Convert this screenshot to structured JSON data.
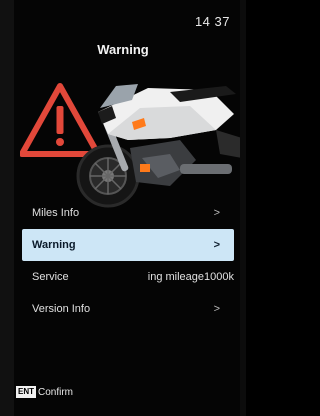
{
  "status_bar": {
    "time": "14 37"
  },
  "header": {
    "title": "Warning"
  },
  "hero": {
    "warning_icon": "warning-triangle-icon",
    "image": "motorcycle"
  },
  "menu": {
    "items": [
      {
        "label": "Miles Info",
        "value": "",
        "chevron": ">",
        "selected": false
      },
      {
        "label": "Warning",
        "value": "",
        "chevron": ">",
        "selected": true
      },
      {
        "label": "Service",
        "value": "ing mileage1000k",
        "chevron": "",
        "selected": false
      },
      {
        "label": "Version Info",
        "value": "",
        "chevron": ">",
        "selected": false
      }
    ]
  },
  "footer": {
    "key_label": "ENT",
    "action_label": "Confirm"
  },
  "colors": {
    "background": "#050505",
    "selected_bg": "#cde6f6",
    "warning_red": "#e2483a"
  }
}
